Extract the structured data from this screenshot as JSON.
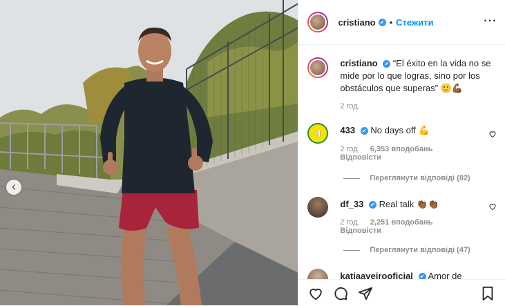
{
  "header": {
    "username": "cristiano",
    "verified_mark": "✔",
    "separator": "•",
    "follow_label": "Стежити",
    "more_label": "···"
  },
  "caption": {
    "username": "cristiano",
    "text": "“El éxito en la vida no se mide por lo que logras, sino por los obstáculos que superas” 🙂💪🏾",
    "time": "2 год."
  },
  "comments": [
    {
      "username": "433",
      "avatar_text": "4",
      "text": "No days off 💪",
      "time": "2 год.",
      "likes": "6,353 вподобань",
      "reply": "Відповісти",
      "view_replies": "Переглянути відповіді (82)"
    },
    {
      "username": "df_33",
      "text": "Real talk 👏🏾👏🏾",
      "time": "2 год.",
      "likes": "2,251 вподобань",
      "reply": "Відповісти",
      "view_replies": "Переглянути відповіді (47)"
    },
    {
      "username": "katiaaveirooficial",
      "text": "Amor de"
    }
  ],
  "photo": {
    "prev_label": "‹"
  },
  "icons": {
    "like": "heart-icon",
    "comment": "comment-icon",
    "share": "paper-plane-icon",
    "save": "bookmark-icon"
  },
  "colors": {
    "accent": "#0095f6",
    "verified": "#3897f0",
    "text": "#262626",
    "muted": "#8e8e8e"
  }
}
